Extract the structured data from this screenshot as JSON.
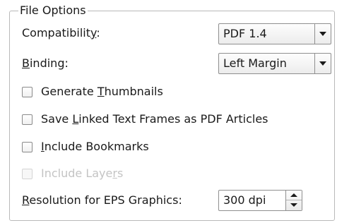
{
  "group": {
    "title": "File Options"
  },
  "compatibility": {
    "label": "Compatibility:",
    "value": "PDF 1.4",
    "mnemonic": "y"
  },
  "binding": {
    "label": "Binding:",
    "value": "Left Margin",
    "mnemonic": "B"
  },
  "checkboxes": [
    {
      "label": "Generate Thumbnails",
      "checked": false,
      "enabled": true,
      "mnemonic": "T"
    },
    {
      "label": "Save Linked Text Frames as PDF Articles",
      "checked": false,
      "enabled": true,
      "mnemonic": "L"
    },
    {
      "label": "Include Bookmarks",
      "checked": false,
      "enabled": true,
      "mnemonic": "I"
    },
    {
      "label": "Include Layers",
      "checked": false,
      "enabled": false,
      "mnemonic": "y"
    }
  ],
  "resolution": {
    "label": "Resolution for EPS Graphics:",
    "value": "300 dpi",
    "mnemonic": "R"
  },
  "icons": {
    "combo_arrow": "chevron-down-icon",
    "spin_up": "spin-up-icon",
    "spin_down": "spin-down-icon"
  },
  "colors": {
    "border": "#8f8f8f",
    "group_border": "#b9b9b9",
    "disabled_text": "#c4c4c4"
  }
}
